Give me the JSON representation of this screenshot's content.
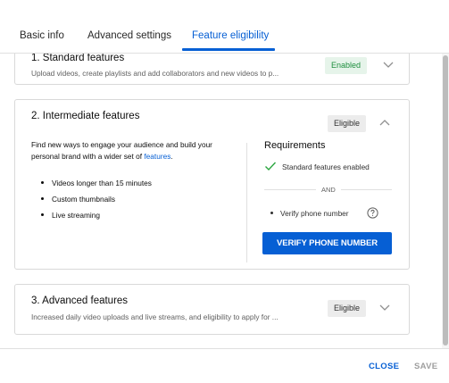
{
  "tabs": [
    {
      "label": "Basic info",
      "active": false
    },
    {
      "label": "Advanced settings",
      "active": false
    },
    {
      "label": "Feature eligibility",
      "active": true
    }
  ],
  "cards": {
    "standard": {
      "title": "1. Standard features",
      "description": "Upload videos, create playlists and add collaborators and new videos to p...",
      "badge": "Enabled",
      "expanded": false
    },
    "intermediate": {
      "title": "2. Intermediate features",
      "badge": "Eligible",
      "expanded": true,
      "description_prefix": "Find new ways to engage your audience and build your personal brand with a wider set of ",
      "description_link": "features",
      "description_suffix": ".",
      "bullets": [
        "Videos longer than 15 minutes",
        "Custom thumbnails",
        "Live streaming"
      ],
      "requirements_title": "Requirements",
      "requirement_done": "Standard features enabled",
      "and_label": "AND",
      "requirement_pending": "Verify phone number",
      "verify_button": "VERIFY PHONE NUMBER"
    },
    "advanced": {
      "title": "3. Advanced features",
      "description": "Increased daily video uploads and live streams, and eligibility to apply for ...",
      "badge": "Eligible",
      "expanded": false
    }
  },
  "footer": {
    "close_label": "CLOSE",
    "save_label": "SAVE"
  },
  "colors": {
    "accent": "#065fd4",
    "enabled_text": "#1e8e3e",
    "enabled_bg": "#e6f4ea",
    "eligible_bg": "#ececec",
    "check_green": "#2ba640"
  },
  "icons": {
    "check": "check-icon",
    "help": "help-circle-icon",
    "chevron_up": "chevron-up-icon",
    "chevron_down": "chevron-down-icon"
  }
}
